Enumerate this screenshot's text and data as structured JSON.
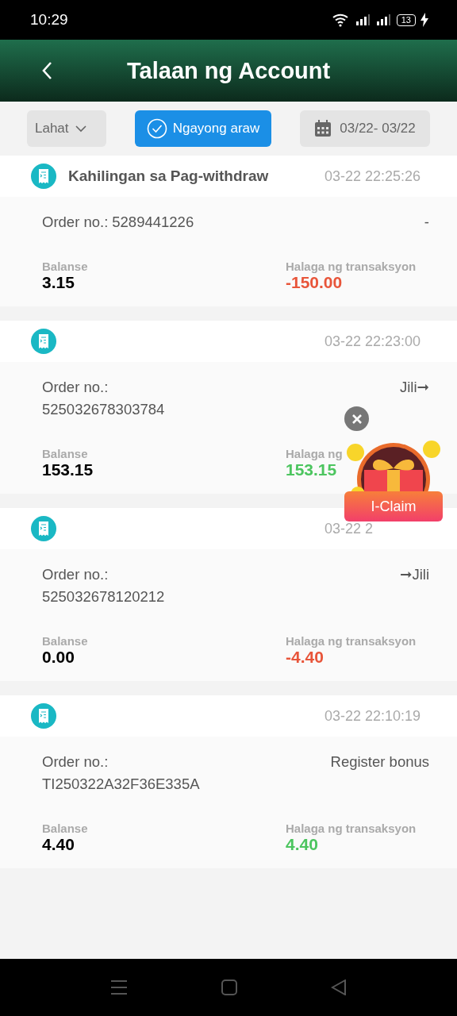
{
  "status_bar": {
    "time": "10:29",
    "battery": "13"
  },
  "header": {
    "title": "Talaan ng Account"
  },
  "filters": [
    {
      "kind": "dropdown",
      "label": "Lahat",
      "selected": false
    },
    {
      "kind": "toggle",
      "label": "Ngayong araw",
      "selected": true
    },
    {
      "kind": "date",
      "label": "03/22- 03/22",
      "selected": false
    }
  ],
  "records": [
    {
      "title": "Kahilingan sa Pag-withdraw",
      "time": "03-22 22:25:26",
      "order_stacked": false,
      "order_label": "Order no.:",
      "order_no": "5289441226",
      "note": "-",
      "balance_label": "Balanse",
      "balance": "3.15",
      "amount_label": "Halaga ng transaksyon",
      "amount": "-150.00",
      "color": "#e8553a"
    },
    {
      "time": "03-22 22:23:00",
      "order_stacked": true,
      "order_label": "Order no.:",
      "order_no": "525032678303784",
      "note": "Jili➞",
      "balance_label": "Balanse",
      "balance": "153.15",
      "amount_label": "Halaga ng",
      "amount": "153.15",
      "color": "#4cc55f"
    },
    {
      "time": "03-22 2",
      "order_stacked": true,
      "order_label": "Order no.:",
      "order_no": "525032678120212",
      "note": "➞Jili",
      "balance_label": "Balanse",
      "balance": "0.00",
      "amount_label": "Halaga ng transaksyon",
      "amount": "-4.40",
      "color": "#e8553a"
    },
    {
      "time": "03-22 22:10:19",
      "order_stacked": true,
      "order_label": "Order no.:",
      "order_no": "TI250322A32F36E335A",
      "note": "Register bonus",
      "balance_label": "Balanse",
      "balance": "4.40",
      "amount_label": "Halaga ng transaksyon",
      "amount": "4.40",
      "color": "#4cc55f"
    }
  ],
  "promo": {
    "button": "I-Claim"
  }
}
